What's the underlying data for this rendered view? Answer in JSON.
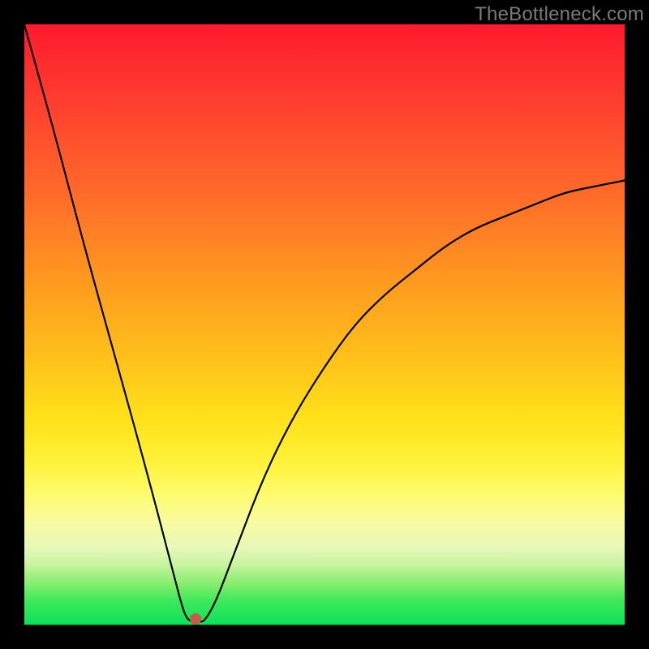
{
  "watermark": "TheBottleneck.com",
  "chart_data": {
    "type": "line",
    "title": "",
    "xlabel": "",
    "ylabel": "",
    "xlim": [
      0,
      100
    ],
    "ylim": [
      0,
      100
    ],
    "grid": false,
    "legend": false,
    "background": "rainbow-vertical",
    "series": [
      {
        "name": "curve",
        "color": "#000000",
        "x": [
          0,
          5,
          10,
          15,
          20,
          25,
          26,
          27,
          28,
          29,
          30,
          32,
          35,
          40,
          45,
          50,
          55,
          60,
          65,
          70,
          75,
          80,
          85,
          90,
          95,
          100
        ],
        "y": [
          100,
          82,
          63,
          45,
          27,
          8,
          4,
          1,
          0.5,
          0.5,
          0.5,
          4,
          12,
          25,
          35,
          43,
          50,
          55,
          59,
          63,
          66,
          68,
          70,
          72,
          73,
          74
        ]
      }
    ],
    "marker": {
      "x": 28.5,
      "y": 1,
      "color": "#c85a4a"
    }
  }
}
